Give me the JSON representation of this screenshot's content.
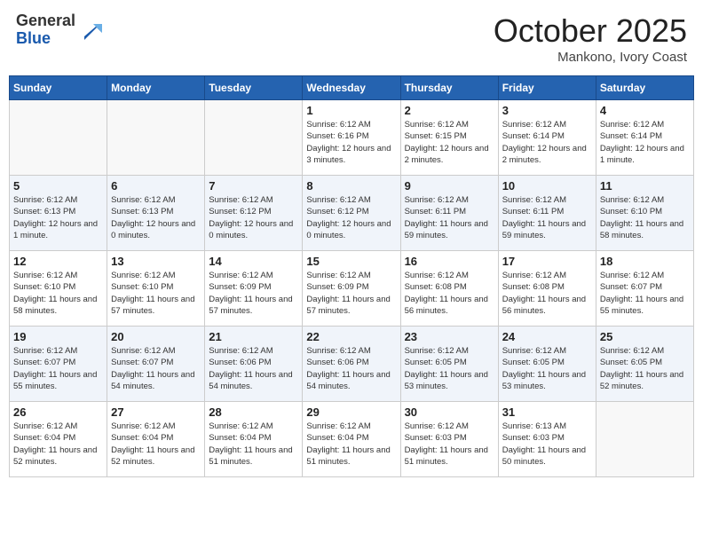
{
  "header": {
    "logo_line1": "General",
    "logo_line2": "Blue",
    "month": "October 2025",
    "location": "Mankono, Ivory Coast"
  },
  "weekdays": [
    "Sunday",
    "Monday",
    "Tuesday",
    "Wednesday",
    "Thursday",
    "Friday",
    "Saturday"
  ],
  "weeks": [
    [
      {
        "day": "",
        "info": ""
      },
      {
        "day": "",
        "info": ""
      },
      {
        "day": "",
        "info": ""
      },
      {
        "day": "1",
        "info": "Sunrise: 6:12 AM\nSunset: 6:16 PM\nDaylight: 12 hours and 3 minutes."
      },
      {
        "day": "2",
        "info": "Sunrise: 6:12 AM\nSunset: 6:15 PM\nDaylight: 12 hours and 2 minutes."
      },
      {
        "day": "3",
        "info": "Sunrise: 6:12 AM\nSunset: 6:14 PM\nDaylight: 12 hours and 2 minutes."
      },
      {
        "day": "4",
        "info": "Sunrise: 6:12 AM\nSunset: 6:14 PM\nDaylight: 12 hours and 1 minute."
      }
    ],
    [
      {
        "day": "5",
        "info": "Sunrise: 6:12 AM\nSunset: 6:13 PM\nDaylight: 12 hours and 1 minute."
      },
      {
        "day": "6",
        "info": "Sunrise: 6:12 AM\nSunset: 6:13 PM\nDaylight: 12 hours and 0 minutes."
      },
      {
        "day": "7",
        "info": "Sunrise: 6:12 AM\nSunset: 6:12 PM\nDaylight: 12 hours and 0 minutes."
      },
      {
        "day": "8",
        "info": "Sunrise: 6:12 AM\nSunset: 6:12 PM\nDaylight: 12 hours and 0 minutes."
      },
      {
        "day": "9",
        "info": "Sunrise: 6:12 AM\nSunset: 6:11 PM\nDaylight: 11 hours and 59 minutes."
      },
      {
        "day": "10",
        "info": "Sunrise: 6:12 AM\nSunset: 6:11 PM\nDaylight: 11 hours and 59 minutes."
      },
      {
        "day": "11",
        "info": "Sunrise: 6:12 AM\nSunset: 6:10 PM\nDaylight: 11 hours and 58 minutes."
      }
    ],
    [
      {
        "day": "12",
        "info": "Sunrise: 6:12 AM\nSunset: 6:10 PM\nDaylight: 11 hours and 58 minutes."
      },
      {
        "day": "13",
        "info": "Sunrise: 6:12 AM\nSunset: 6:10 PM\nDaylight: 11 hours and 57 minutes."
      },
      {
        "day": "14",
        "info": "Sunrise: 6:12 AM\nSunset: 6:09 PM\nDaylight: 11 hours and 57 minutes."
      },
      {
        "day": "15",
        "info": "Sunrise: 6:12 AM\nSunset: 6:09 PM\nDaylight: 11 hours and 57 minutes."
      },
      {
        "day": "16",
        "info": "Sunrise: 6:12 AM\nSunset: 6:08 PM\nDaylight: 11 hours and 56 minutes."
      },
      {
        "day": "17",
        "info": "Sunrise: 6:12 AM\nSunset: 6:08 PM\nDaylight: 11 hours and 56 minutes."
      },
      {
        "day": "18",
        "info": "Sunrise: 6:12 AM\nSunset: 6:07 PM\nDaylight: 11 hours and 55 minutes."
      }
    ],
    [
      {
        "day": "19",
        "info": "Sunrise: 6:12 AM\nSunset: 6:07 PM\nDaylight: 11 hours and 55 minutes."
      },
      {
        "day": "20",
        "info": "Sunrise: 6:12 AM\nSunset: 6:07 PM\nDaylight: 11 hours and 54 minutes."
      },
      {
        "day": "21",
        "info": "Sunrise: 6:12 AM\nSunset: 6:06 PM\nDaylight: 11 hours and 54 minutes."
      },
      {
        "day": "22",
        "info": "Sunrise: 6:12 AM\nSunset: 6:06 PM\nDaylight: 11 hours and 54 minutes."
      },
      {
        "day": "23",
        "info": "Sunrise: 6:12 AM\nSunset: 6:05 PM\nDaylight: 11 hours and 53 minutes."
      },
      {
        "day": "24",
        "info": "Sunrise: 6:12 AM\nSunset: 6:05 PM\nDaylight: 11 hours and 53 minutes."
      },
      {
        "day": "25",
        "info": "Sunrise: 6:12 AM\nSunset: 6:05 PM\nDaylight: 11 hours and 52 minutes."
      }
    ],
    [
      {
        "day": "26",
        "info": "Sunrise: 6:12 AM\nSunset: 6:04 PM\nDaylight: 11 hours and 52 minutes."
      },
      {
        "day": "27",
        "info": "Sunrise: 6:12 AM\nSunset: 6:04 PM\nDaylight: 11 hours and 52 minutes."
      },
      {
        "day": "28",
        "info": "Sunrise: 6:12 AM\nSunset: 6:04 PM\nDaylight: 11 hours and 51 minutes."
      },
      {
        "day": "29",
        "info": "Sunrise: 6:12 AM\nSunset: 6:04 PM\nDaylight: 11 hours and 51 minutes."
      },
      {
        "day": "30",
        "info": "Sunrise: 6:12 AM\nSunset: 6:03 PM\nDaylight: 11 hours and 51 minutes."
      },
      {
        "day": "31",
        "info": "Sunrise: 6:13 AM\nSunset: 6:03 PM\nDaylight: 11 hours and 50 minutes."
      },
      {
        "day": "",
        "info": ""
      }
    ]
  ]
}
